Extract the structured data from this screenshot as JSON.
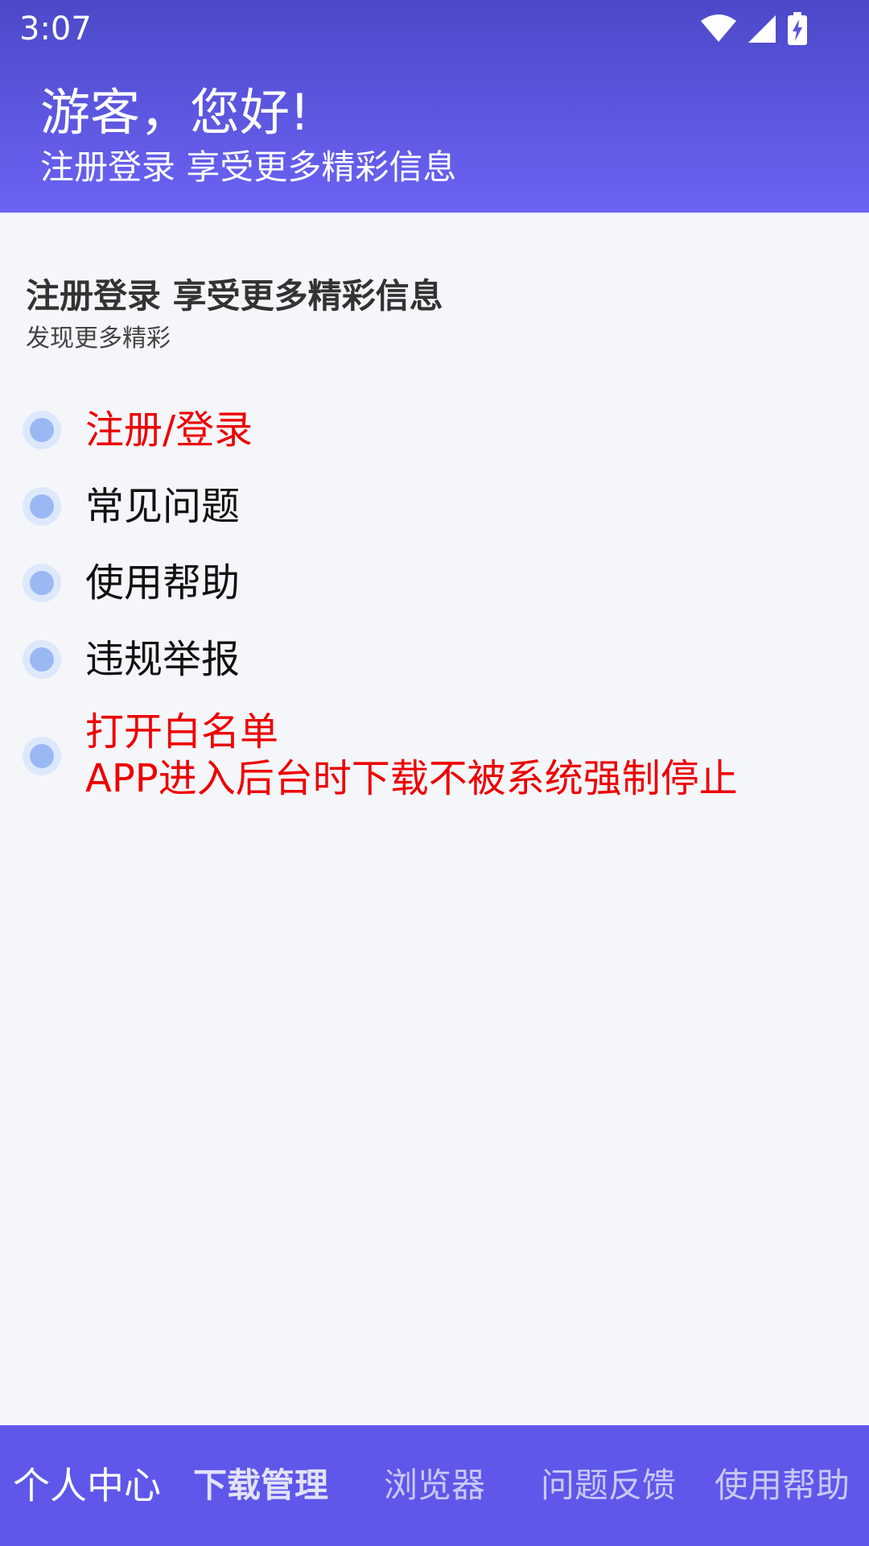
{
  "status_bar": {
    "time": "3:07",
    "icons": [
      "wifi-icon",
      "signal-icon",
      "battery-charging-icon"
    ]
  },
  "header": {
    "greeting": "游客，您好!",
    "subtitle": "注册登录 享受更多精彩信息"
  },
  "section": {
    "title": "注册登录 享受更多精彩信息",
    "subtitle": "发现更多精彩"
  },
  "menu": {
    "items": [
      {
        "label": "注册/登录"
      },
      {
        "label": "常见问题"
      },
      {
        "label": "使用帮助"
      },
      {
        "label": "违规举报"
      },
      {
        "label": "打开白名单",
        "label_line2": "APP进入后台时下载不被系统强制停止"
      }
    ]
  },
  "bottom_nav": {
    "items": [
      {
        "label": "个人中心"
      },
      {
        "label": "下载管理"
      },
      {
        "label": "浏览器"
      },
      {
        "label": "问题反馈"
      },
      {
        "label": "使用帮助"
      }
    ]
  },
  "colors": {
    "header_top": "#4b49c8",
    "header_bottom": "#6b63f4",
    "bottom_nav": "#5e57ea",
    "highlight_red": "#ee0000",
    "radio": "#9ab9f4"
  }
}
